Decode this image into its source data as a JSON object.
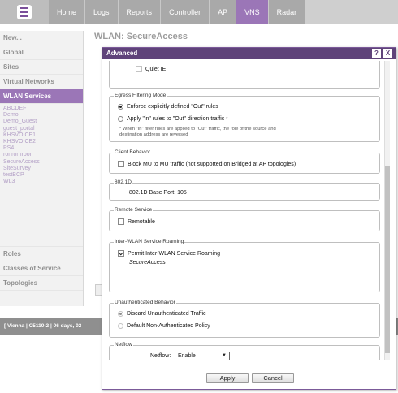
{
  "nav": {
    "items": [
      "Home",
      "Logs",
      "Reports",
      "Controller",
      "AP",
      "VNS",
      "Radar"
    ],
    "active": "VNS",
    "accent": "#9b76b7"
  },
  "sidebar": {
    "sections_top": [
      "New...",
      "Global",
      "Sites",
      "Virtual Networks",
      "WLAN Services"
    ],
    "active": "WLAN Services",
    "wlans": [
      "ABCDEF",
      "Demo",
      "Demo_Guest",
      "guest_portal",
      "KHSVOICE1",
      "KHSVOICE2",
      "PS4",
      "ronrornroor",
      "SecureAccess",
      "SiteSurvey",
      "testBCP",
      "WL3"
    ],
    "sections_bottom": [
      "Roles",
      "Classes of Service",
      "Topologies"
    ]
  },
  "page": {
    "title": "WLAN: SecureAccess"
  },
  "statusbar": {
    "text": "[ Vienna | C5110-2 | 06 days, 02"
  },
  "modal": {
    "title": "Advanced",
    "help": "?",
    "close": "X",
    "quiet_ie": "Quiet IE",
    "egress": {
      "legend": "Egress Filtering Mode",
      "opt1": "Enforce explicitly defined \"Out\" rules",
      "opt2": "Apply \"in\" rules to \"Out\" direction traffic",
      "opt2_mark": "*",
      "note1": "* When \"In\" filter rules are applied to \"Out\" traffic, the role of the source and",
      "note2": "destination address are reversed"
    },
    "client": {
      "legend": "Client Behavior",
      "block": "Block MU to MU traffic (not supported on Bridged at AP topologies)"
    },
    "dot1d": {
      "legend": "802.1D",
      "port": "802.1D Base Port: 105"
    },
    "remote": {
      "legend": "Remote Service",
      "remotable": "Remotable"
    },
    "roaming": {
      "legend": "Inter-WLAN Service Roaming",
      "permit": "Permit Inter-WLAN Service Roaming",
      "service": "SecureAccess"
    },
    "unauth": {
      "legend": "Unauthenticated Behavior",
      "discard": "Discard Unauthenticated Traffic",
      "default": "Default Non-Authenticated Policy"
    },
    "netflow": {
      "legend": "Netflow",
      "label": "Netflow:",
      "value": "Enable"
    },
    "apply": "Apply",
    "cancel": "Cancel"
  }
}
